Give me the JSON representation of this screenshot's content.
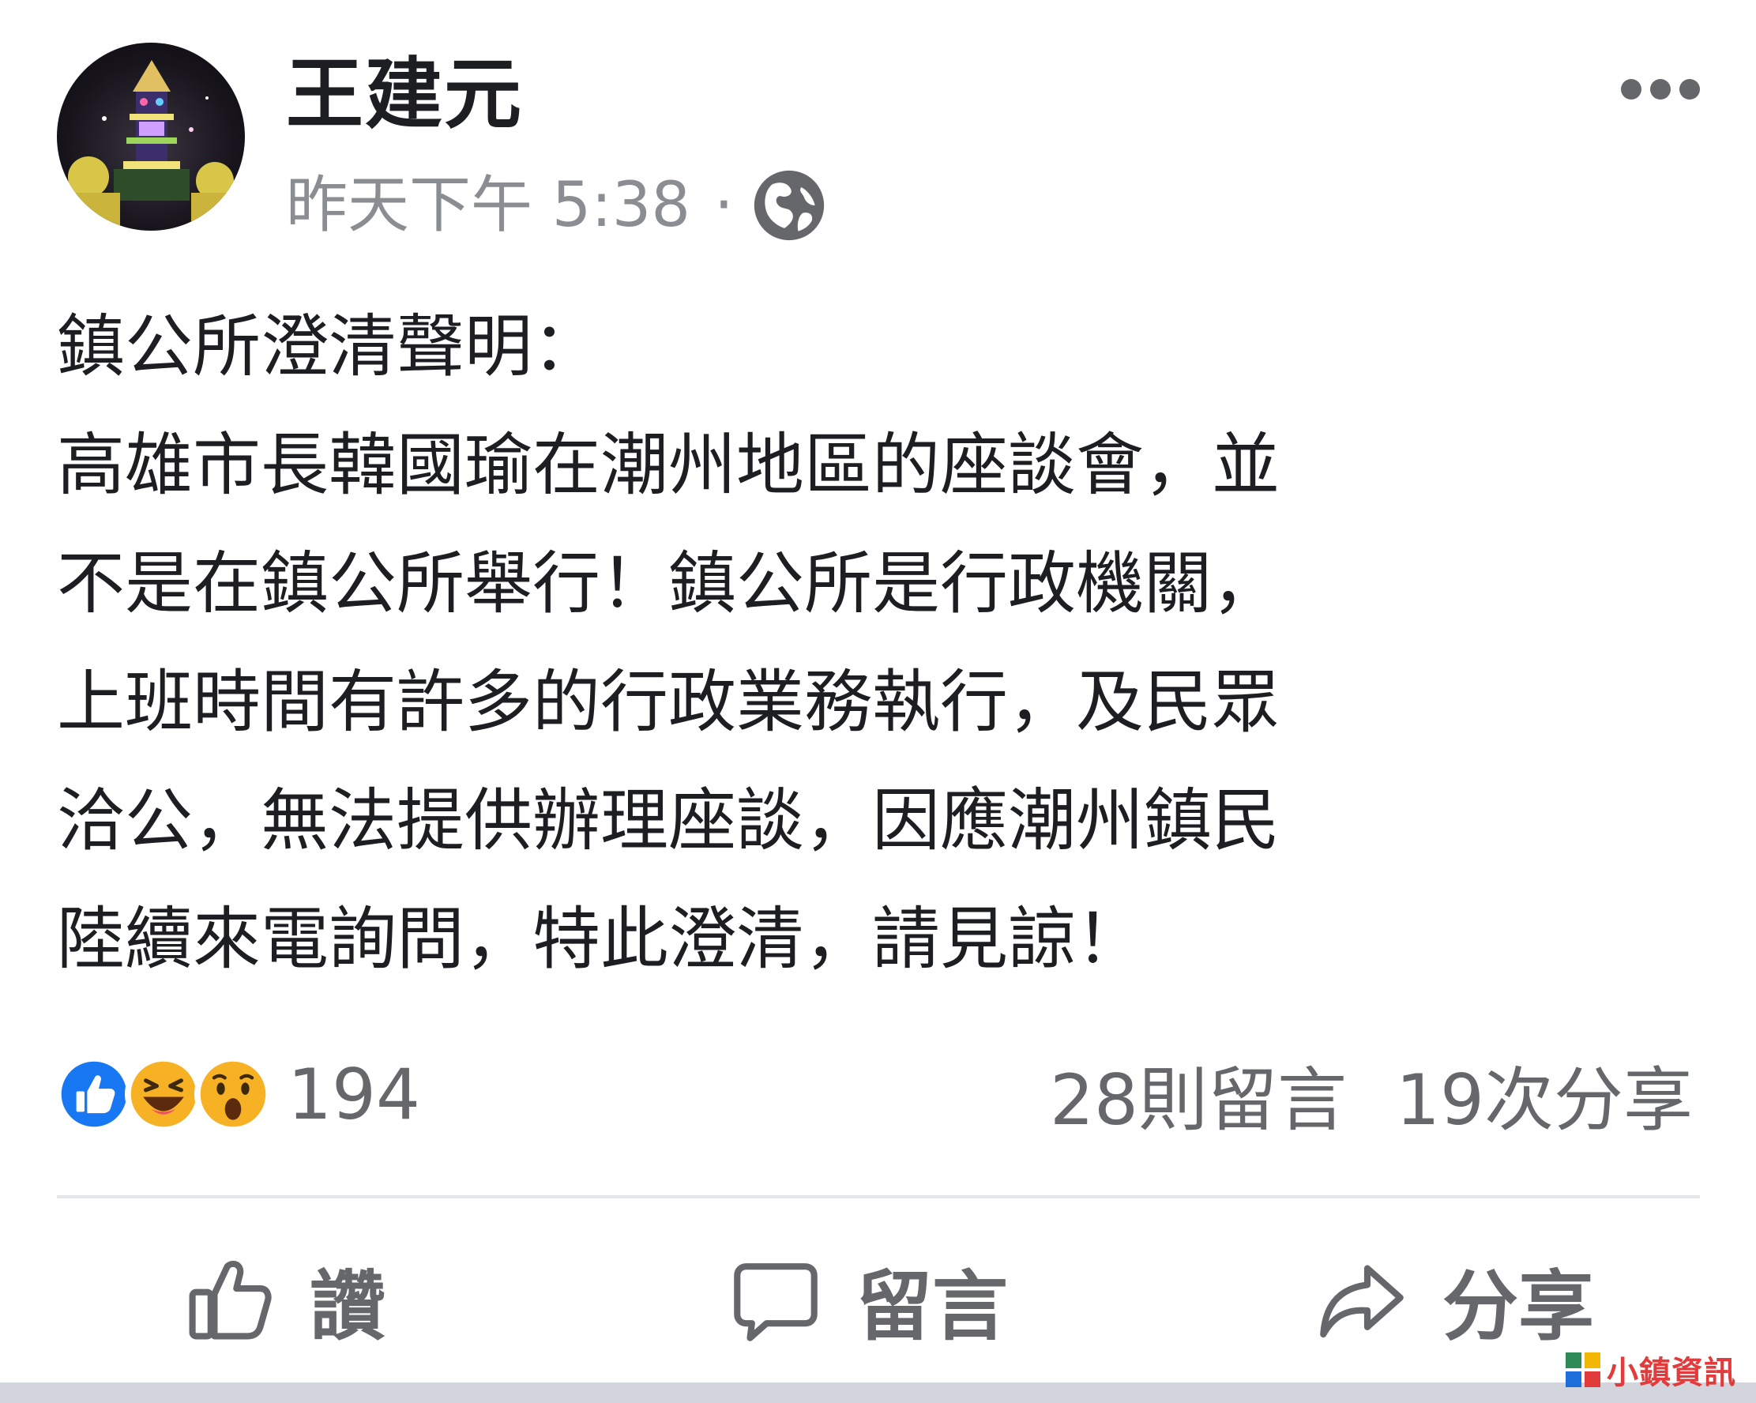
{
  "post": {
    "author": "王建元",
    "timestamp": "昨天下午 5:38",
    "separator": "·",
    "privacy_icon": "globe-icon",
    "more_icon": "more-dots-icon",
    "body_lines": [
      "鎮公所澄清聲明：",
      "高雄市長韓國瑜在潮州地區的座談會，並",
      "不是在鎮公所舉行！鎮公所是行政機關，",
      "上班時間有許多的行政業務執行，及民眾",
      "洽公，無法提供辦理座談，因應潮州鎮民",
      "陸續來電詢問，特此澄清，請見諒！"
    ]
  },
  "engagement": {
    "reaction_icons": [
      "like-reaction-icon",
      "haha-reaction-icon",
      "wow-reaction-icon"
    ],
    "reaction_count": "194",
    "comments": "28則留言",
    "shares": "19次分享"
  },
  "actions": {
    "like_label": "讚",
    "comment_label": "留言",
    "share_label": "分享"
  },
  "watermark": {
    "text": "小鎮資訊"
  },
  "colors": {
    "text_primary": "#1c1e21",
    "text_secondary": "#65676b",
    "like_blue": "#1877f2",
    "reaction_yellow": "#f7b125",
    "divider": "#e4e6eb"
  }
}
